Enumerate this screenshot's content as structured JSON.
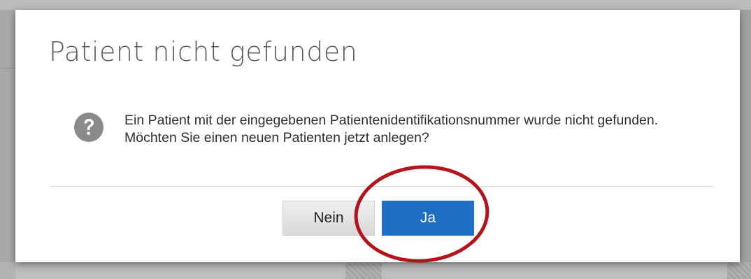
{
  "dialog": {
    "title": "Patient nicht gefunden",
    "message": "Ein Patient mit der eingegebenen Patientenidentifikationsnummer wurde nicht gefunden. Möchten Sie einen neuen Patienten jetzt anlegen?",
    "icon": "question-circle-icon",
    "buttons": {
      "no_label": "Nein",
      "yes_label": "Ja"
    }
  },
  "annotation": {
    "type": "red-ellipse-highlight",
    "target": "yes-button",
    "color": "#b5121b"
  },
  "colors": {
    "primary_button": "#1f6fc7",
    "secondary_button": "#e3e3e3",
    "icon": "#8a8a8a",
    "title_text": "#5d5d5d"
  }
}
